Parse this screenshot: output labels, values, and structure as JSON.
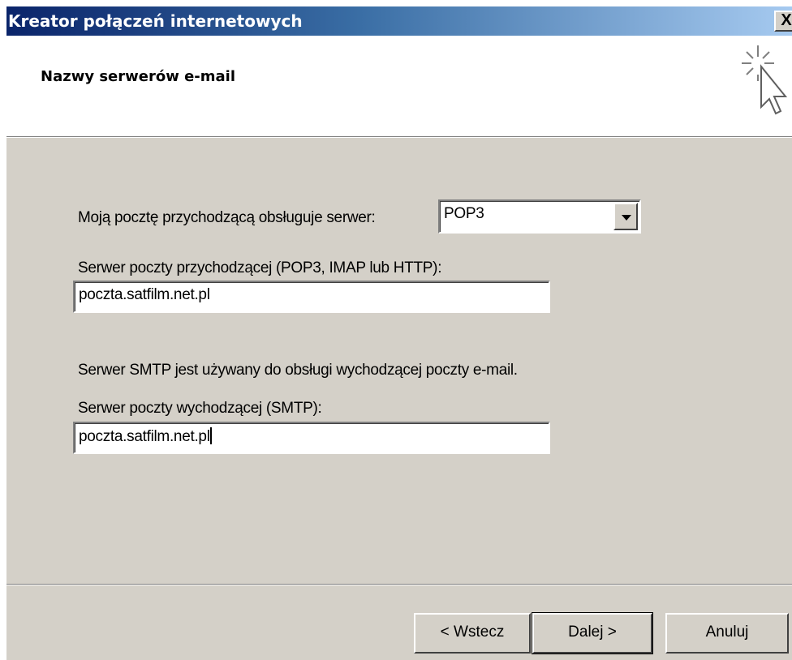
{
  "window": {
    "title": "Kreator połączeń internetowych",
    "close_label": "X"
  },
  "header": {
    "title": "Nazwy serwerów e-mail",
    "icon": "wizard-cursor-icon"
  },
  "form": {
    "incoming_type_label": "Moją pocztę przychodzącą obsługuje serwer:",
    "incoming_type_value": "POP3",
    "incoming_server_label": "Serwer poczty przychodzącej (POP3, IMAP lub HTTP):",
    "incoming_server_value": "poczta.satfilm.net.pl",
    "smtp_info": "Serwer SMTP jest używany do obsługi wychodzącej poczty e-mail.",
    "outgoing_server_label": "Serwer poczty wychodzącej (SMTP):",
    "outgoing_server_value": "poczta.satfilm.net.pl"
  },
  "buttons": {
    "back": "< Wstecz",
    "next": "Dalej >",
    "cancel": "Anuluj"
  },
  "colors": {
    "titlebar_start": "#0a246a",
    "titlebar_end": "#a6caf0",
    "dialog_bg": "#d4d0c8"
  }
}
